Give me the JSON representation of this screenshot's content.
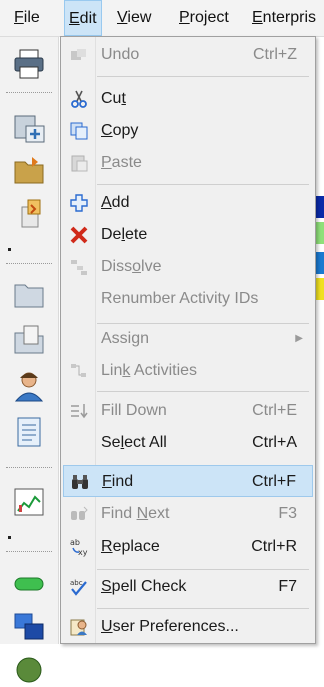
{
  "menubar": {
    "items": [
      {
        "label": "File",
        "ul": "F",
        "rest": "ile"
      },
      {
        "label": "Edit",
        "ul": "E",
        "rest": "dit"
      },
      {
        "label": "View",
        "ul": "V",
        "rest": "iew"
      },
      {
        "label": "Project",
        "ul": "P",
        "rest": "roject"
      },
      {
        "label": "Enterprise",
        "ul": "E",
        "rest": "nterpris"
      }
    ]
  },
  "menu": {
    "undo": {
      "label": "Undo",
      "shortcut": "Ctrl+Z"
    },
    "cut": {
      "pre": "Cu",
      "ul": "t",
      "post": ""
    },
    "copy": {
      "pre": "",
      "ul": "C",
      "post": "opy"
    },
    "paste": {
      "pre": "",
      "ul": "P",
      "post": "aste"
    },
    "add": {
      "pre": "",
      "ul": "A",
      "post": "dd"
    },
    "delete": {
      "pre": "De",
      "ul": "l",
      "post": "ete"
    },
    "dissolve": {
      "pre": "Diss",
      "ul": "o",
      "post": "lve"
    },
    "renumber": {
      "label": "Renumber Activity IDs"
    },
    "assign": {
      "pre": "Assi",
      "ul": "g",
      "post": "n"
    },
    "link": {
      "pre": "Lin",
      "ul": "k",
      "post": " Activities"
    },
    "filldown": {
      "label": "Fill Down",
      "shortcut": "Ctrl+E"
    },
    "selectall": {
      "pre": "Se",
      "ul": "l",
      "post": "ect All",
      "shortcut": "Ctrl+A"
    },
    "find": {
      "pre": "",
      "ul": "F",
      "post": "ind",
      "shortcut": "Ctrl+F"
    },
    "findnext": {
      "pre": "Find ",
      "ul": "N",
      "post": "ext",
      "shortcut": "F3"
    },
    "replace": {
      "pre": "",
      "ul": "R",
      "post": "eplace",
      "shortcut": "Ctrl+R"
    },
    "spell": {
      "pre": "",
      "ul": "S",
      "post": "pell Check",
      "shortcut": "F7"
    },
    "prefs": {
      "pre": "",
      "ul": "U",
      "post": "ser Preferences..."
    }
  }
}
